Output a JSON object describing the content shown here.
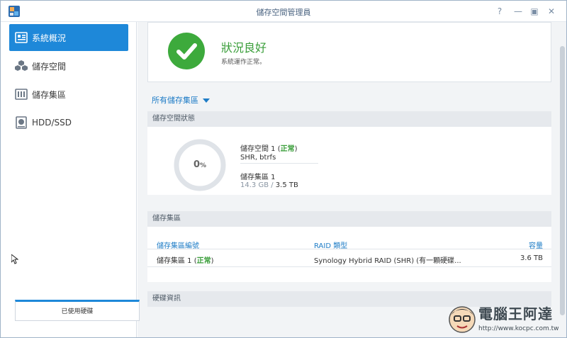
{
  "window": {
    "title": "儲存空間管理員",
    "controls": {
      "help": "?",
      "minimize": "—",
      "maximize": "▣",
      "close": "✕"
    }
  },
  "sidebar": {
    "items": [
      {
        "label": "系統概況",
        "icon": "overview-icon",
        "active": true
      },
      {
        "label": "儲存空間",
        "icon": "storage-cubes-icon",
        "active": false
      },
      {
        "label": "儲存集區",
        "icon": "storage-pool-icon",
        "active": false
      },
      {
        "label": "HDD/SSD",
        "icon": "hdd-icon",
        "active": false
      }
    ]
  },
  "status": {
    "title": "狀況良好",
    "subtitle": "系統運作正常。"
  },
  "filter": {
    "label": "所有儲存集區"
  },
  "volume_panel": {
    "header": "儲存空間狀態",
    "gauge_value": "0",
    "gauge_unit": "%",
    "volume_name": "儲存空間 1",
    "volume_status_open": "(",
    "volume_status": "正常",
    "volume_status_close": ")",
    "volume_fs": "SHR, btrfs",
    "pool_name": "儲存集區 1",
    "used": "14.3 GB",
    "total_sep": " / ",
    "total": "3.5 TB"
  },
  "pool_panel": {
    "header": "儲存集區",
    "columns": [
      "儲存集區編號",
      "RAID 類型",
      "容量"
    ],
    "rows": [
      {
        "name": "儲存集區 1",
        "status": "正常",
        "raid": "Synology Hybrid RAID (SHR) (有一顆硬碟...",
        "capacity": "3.6 TB"
      }
    ]
  },
  "disk_panel": {
    "header": "硬碟資訊",
    "card_label": "已使用硬碟"
  },
  "watermark": {
    "title": "電腦王阿達",
    "url": "http://www.kocpc.com.tw"
  },
  "colors": {
    "accent": "#1e88d9",
    "ok_green": "#3daa3c",
    "link_blue": "#1e7cc6"
  }
}
